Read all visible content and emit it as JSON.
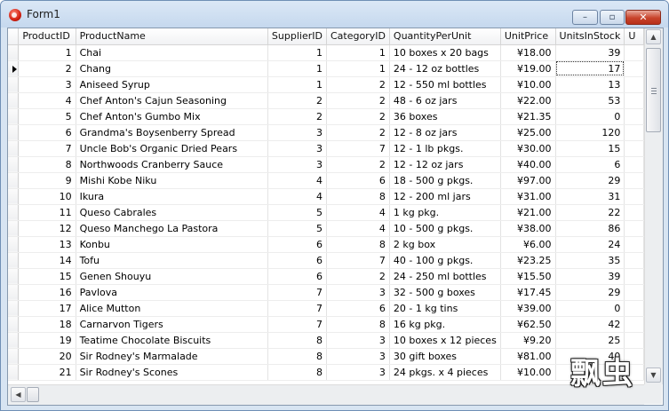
{
  "window": {
    "title": "Form1"
  },
  "controls": {
    "minimize": "–",
    "maximize": "▫",
    "close": "✕"
  },
  "columns": [
    "ProductID",
    "ProductName",
    "SupplierID",
    "CategoryID",
    "QuantityPerUnit",
    "UnitPrice",
    "UnitsInStock",
    "U"
  ],
  "rows": [
    [
      "1",
      "Chai",
      "1",
      "1",
      "10 boxes x 20 bags",
      "¥18.00",
      "39"
    ],
    [
      "2",
      "Chang",
      "1",
      "1",
      "24 - 12 oz bottles",
      "¥19.00",
      "17"
    ],
    [
      "3",
      "Aniseed Syrup",
      "1",
      "2",
      "12 - 550 ml bottles",
      "¥10.00",
      "13"
    ],
    [
      "4",
      "Chef Anton's Cajun Seasoning",
      "2",
      "2",
      "48 - 6 oz jars",
      "¥22.00",
      "53"
    ],
    [
      "5",
      "Chef Anton's Gumbo Mix",
      "2",
      "2",
      "36 boxes",
      "¥21.35",
      "0"
    ],
    [
      "6",
      "Grandma's Boysenberry Spread",
      "3",
      "2",
      "12 - 8 oz jars",
      "¥25.00",
      "120"
    ],
    [
      "7",
      "Uncle Bob's Organic Dried Pears",
      "3",
      "7",
      "12 - 1 lb pkgs.",
      "¥30.00",
      "15"
    ],
    [
      "8",
      "Northwoods Cranberry Sauce",
      "3",
      "2",
      "12 - 12 oz jars",
      "¥40.00",
      "6"
    ],
    [
      "9",
      "Mishi Kobe Niku",
      "4",
      "6",
      "18 - 500 g pkgs.",
      "¥97.00",
      "29"
    ],
    [
      "10",
      "Ikura",
      "4",
      "8",
      "12 - 200 ml jars",
      "¥31.00",
      "31"
    ],
    [
      "11",
      "Queso Cabrales",
      "5",
      "4",
      "1 kg pkg.",
      "¥21.00",
      "22"
    ],
    [
      "12",
      "Queso Manchego La Pastora",
      "5",
      "4",
      "10 - 500 g pkgs.",
      "¥38.00",
      "86"
    ],
    [
      "13",
      "Konbu",
      "6",
      "8",
      "2 kg box",
      "¥6.00",
      "24"
    ],
    [
      "14",
      "Tofu",
      "6",
      "7",
      "40 - 100 g pkgs.",
      "¥23.25",
      "35"
    ],
    [
      "15",
      "Genen Shouyu",
      "6",
      "2",
      "24 - 250 ml bottles",
      "¥15.50",
      "39"
    ],
    [
      "16",
      "Pavlova",
      "7",
      "3",
      "32 - 500 g boxes",
      "¥17.45",
      "29"
    ],
    [
      "17",
      "Alice Mutton",
      "7",
      "6",
      "20 - 1 kg tins",
      "¥39.00",
      "0"
    ],
    [
      "18",
      "Carnarvon Tigers",
      "7",
      "8",
      "16 kg pkg.",
      "¥62.50",
      "42"
    ],
    [
      "19",
      "Teatime Chocolate Biscuits",
      "8",
      "3",
      "10 boxes x 12 pieces",
      "¥9.20",
      "25"
    ],
    [
      "20",
      "Sir Rodney's Marmalade",
      "8",
      "3",
      "30 gift boxes",
      "¥81.00",
      "40"
    ],
    [
      "21",
      "Sir Rodney's Scones",
      "8",
      "3",
      "24 pkgs. x 4 pieces",
      "¥10.00",
      "3"
    ]
  ],
  "current_row_index": 1,
  "selected_cell_column": 6,
  "watermark": "飘虫"
}
